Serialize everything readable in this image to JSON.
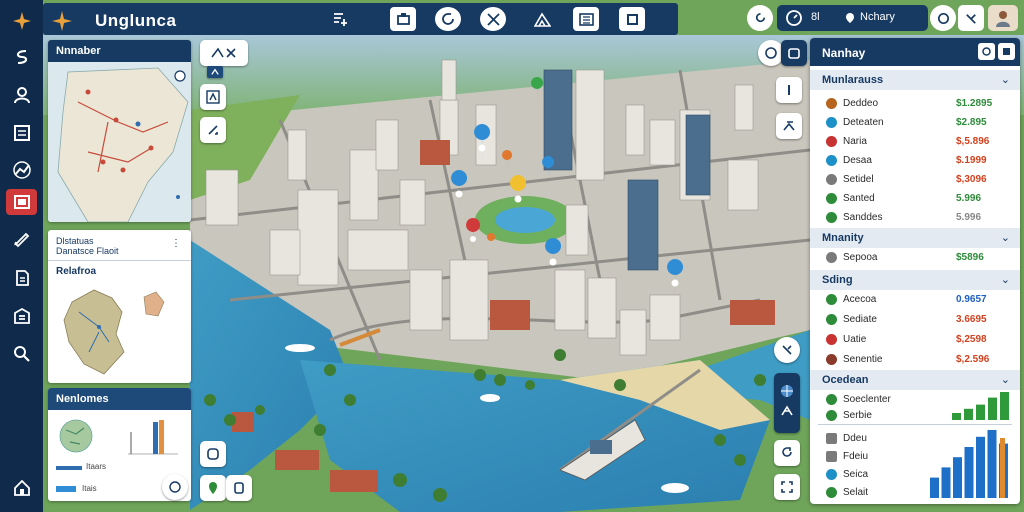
{
  "app": {
    "title": "Unglunca"
  },
  "status": {
    "text_a": "8l",
    "text_b": "Nchary"
  },
  "left_panels": {
    "overview": {
      "title": "Nnnaber"
    },
    "info": {
      "line1": "Dlstatuas",
      "line2": "Danatsce Flaoit",
      "subtitle": "Relafroa"
    },
    "bottom": {
      "title": "Nenlomes",
      "bar_label_1": "Itaars",
      "bar_label_2": "Itais"
    }
  },
  "right_panel": {
    "title": "Nanhay",
    "sections": [
      {
        "label": "Munlarauss",
        "rows": [
          {
            "name": "Deddeo",
            "value": "$1.2895",
            "color": "#2e8b3a",
            "dot": "#b5651d"
          },
          {
            "name": "Deteaten",
            "value": "$2.895",
            "color": "#2e8b3a",
            "dot": "#1e90c8"
          },
          {
            "name": "Naria",
            "value": "$,5.896",
            "color": "#d0421f",
            "dot": "#c83232"
          },
          {
            "name": "Desaa",
            "value": "$.1999",
            "color": "#d0421f",
            "dot": "#1e90c8"
          },
          {
            "name": "Setidel",
            "value": "$,3096",
            "color": "#d0421f",
            "dot": "#7a7a7a"
          },
          {
            "name": "Santed",
            "value": "5.996",
            "color": "#2e8b3a",
            "dot": "#2e8b3a"
          },
          {
            "name": "Sanddes",
            "value": "5.996",
            "color": "#888888",
            "dot": "#2e8b3a"
          }
        ]
      },
      {
        "label": "Mnanity",
        "rows": [
          {
            "name": "Sepooa",
            "value": "$5896",
            "color": "#2e8b3a",
            "dot": "#7a7a7a"
          }
        ]
      },
      {
        "label": "Sding",
        "rows": [
          {
            "name": "Acecoa",
            "value": "0.9657",
            "color": "#2060c0",
            "dot": "#2e8b3a"
          },
          {
            "name": "Sediate",
            "value": "3.6695",
            "color": "#d0421f",
            "dot": "#2e8b3a"
          },
          {
            "name": "Uatie",
            "value": "$,2598",
            "color": "#d0421f",
            "dot": "#c83232"
          },
          {
            "name": "Senentie",
            "value": "$,2.596",
            "color": "#d0421f",
            "dot": "#8a3a2a"
          }
        ]
      },
      {
        "label": "Ocedean",
        "rows": [
          {
            "name": "Soeclenter",
            "value": "",
            "color": "#2e8b3a",
            "dot": "#2e8b3a"
          },
          {
            "name": "Serbie",
            "value": "",
            "color": "#2e8b3a",
            "dot": "#2e8b3a"
          },
          {
            "name": "Ddeu",
            "value": "",
            "color": "#2e8b3a",
            "dot": "#7a7a7a"
          },
          {
            "name": "Fdeiu",
            "value": "",
            "color": "#2e8b3a",
            "dot": "#7a7a7a"
          },
          {
            "name": "Seica",
            "value": "",
            "color": "#2e8b3a",
            "dot": "#1e90c8"
          },
          {
            "name": "Selait",
            "value": "",
            "color": "#2e8b3a",
            "dot": "#2e8b3a"
          }
        ]
      }
    ],
    "green_bars": [
      0.25,
      0.4,
      0.55,
      0.8,
      1.0
    ],
    "blue_bars": [
      0.3,
      0.45,
      0.6,
      0.75,
      0.9,
      1.0,
      0.8
    ]
  }
}
